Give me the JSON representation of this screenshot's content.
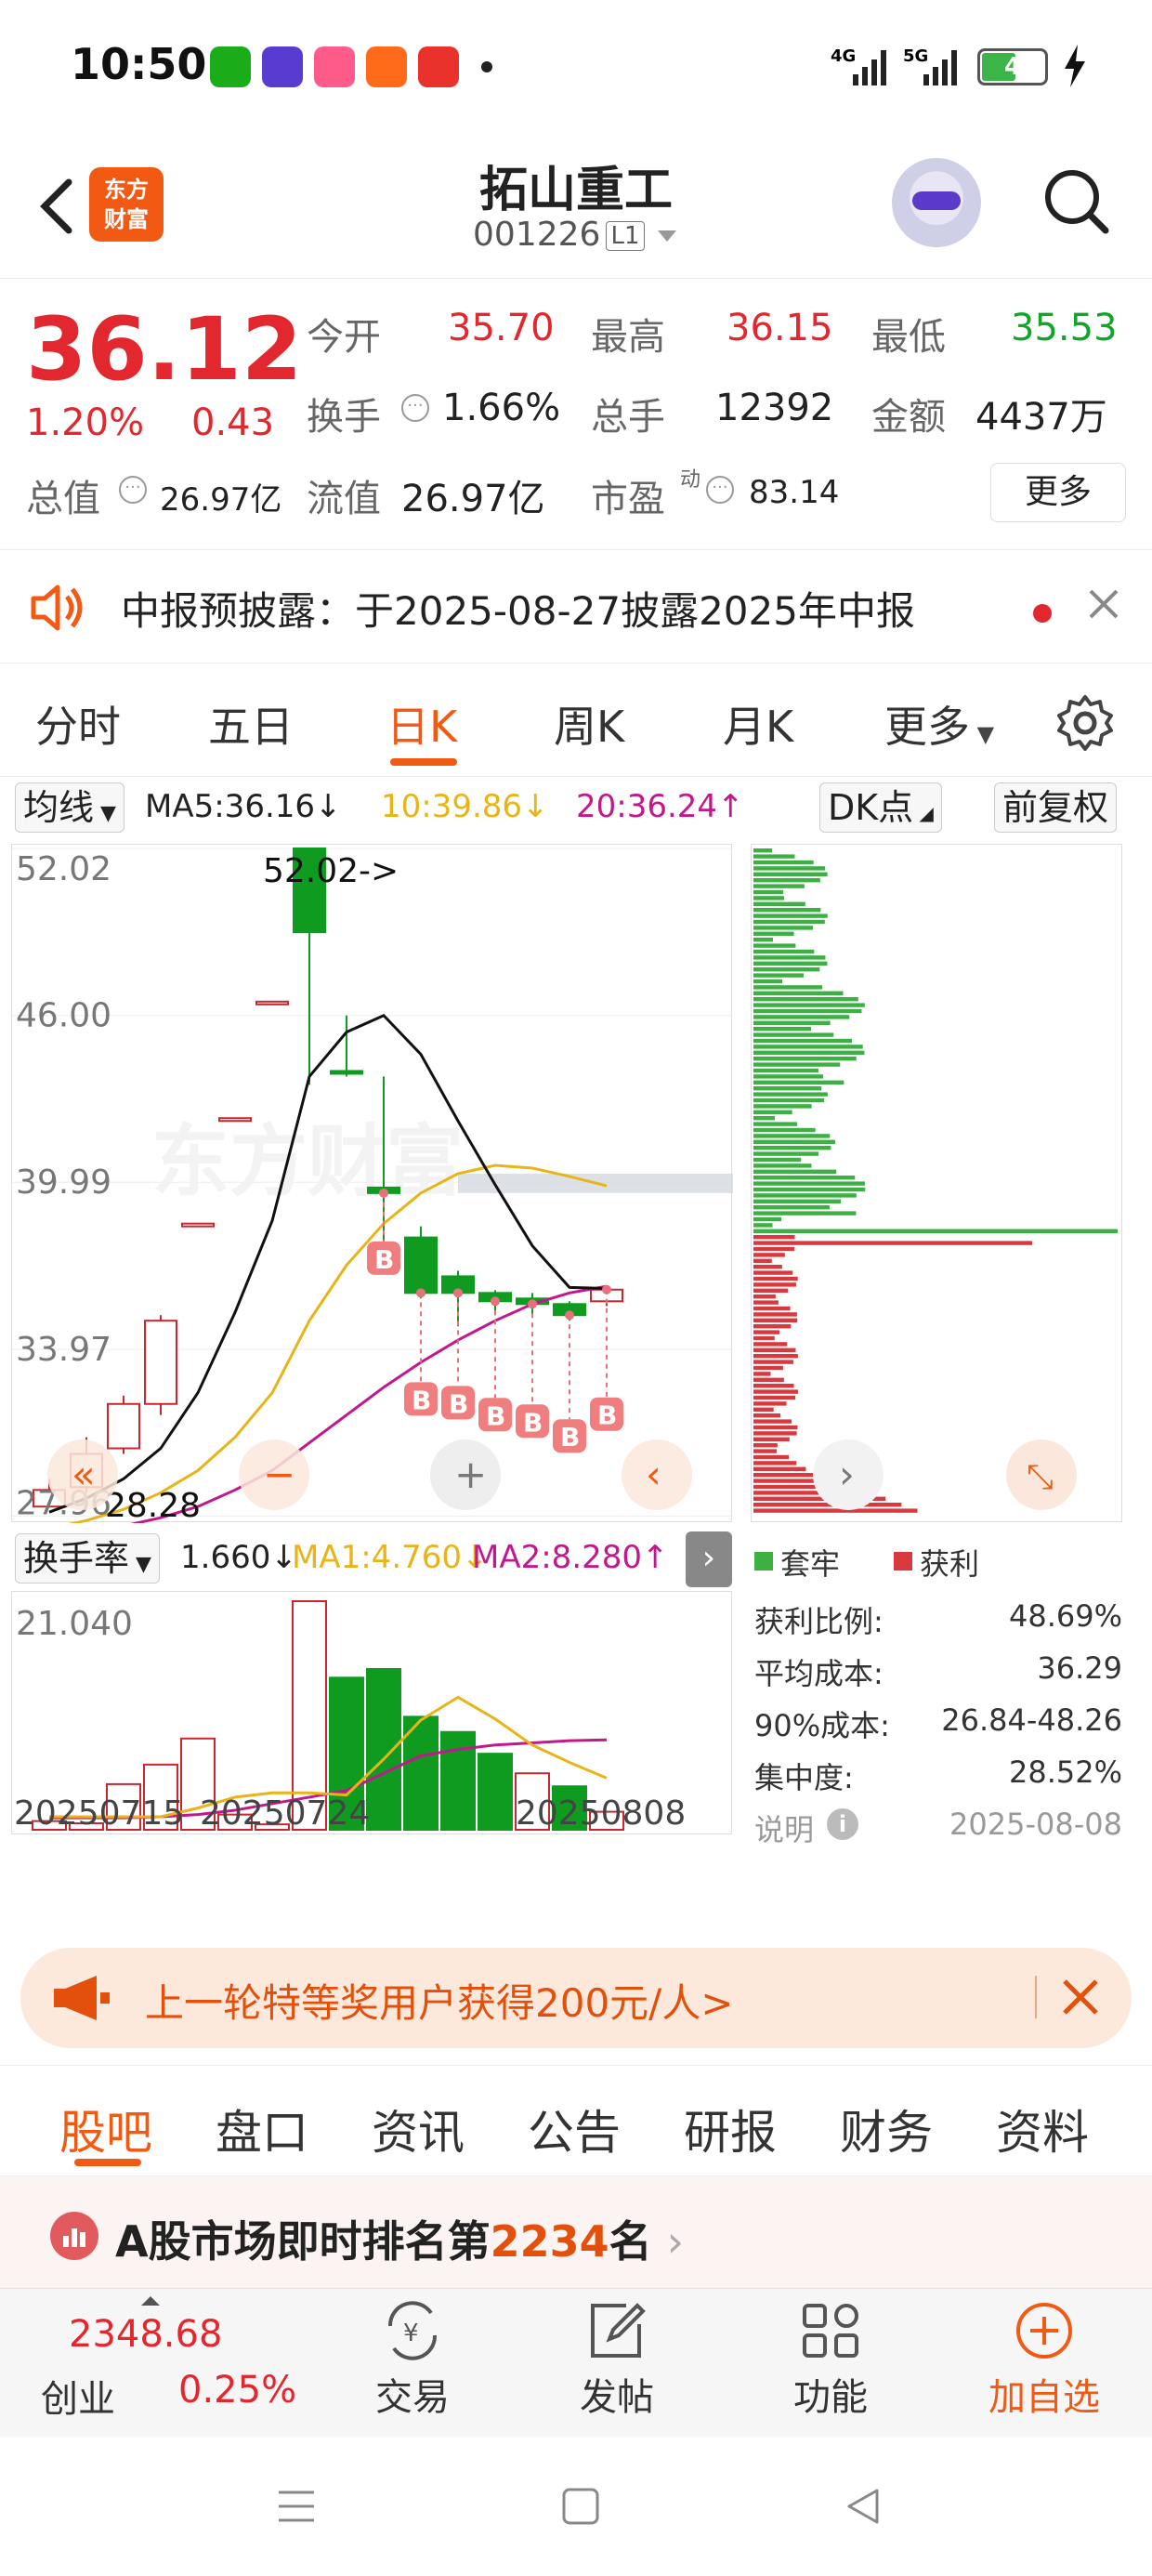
{
  "status_bar": {
    "time": "10:50",
    "network": "4G 5G",
    "battery": "4"
  },
  "header": {
    "logo_text": "东方\n财富",
    "stock_name": "拓山重工",
    "stock_code": "001226",
    "level_badge": "L1"
  },
  "quote": {
    "price": "36.12",
    "change_pct": "1.20%",
    "change_amt": "0.43",
    "fields": [
      {
        "label": "今开",
        "value": "35.70",
        "color": "#e2272e"
      },
      {
        "label": "最高",
        "value": "36.15",
        "color": "#e2272e"
      },
      {
        "label": "最低",
        "value": "35.53",
        "color": "#13a52a"
      },
      {
        "label": "换手",
        "value": "1.66%",
        "color": "#222222"
      },
      {
        "label": "总手",
        "value": "12392",
        "color": "#222222"
      },
      {
        "label": "金额",
        "value": "4437万",
        "color": "#222222"
      },
      {
        "label": "总值",
        "value": "26.97亿",
        "color": "#222222"
      },
      {
        "label": "流值",
        "value": "26.97亿",
        "color": "#222222"
      },
      {
        "label": "市盈",
        "value": "83.14",
        "color": "#222222"
      }
    ],
    "pe_superscript": "动",
    "more_label": "更多"
  },
  "notice": {
    "text": "中报预披露：于2025-08-27披露2025年中报"
  },
  "period_tabs": [
    "分时",
    "五日",
    "日K",
    "周K",
    "月K",
    "更多"
  ],
  "active_period": "日K",
  "ma_row": {
    "selector": "均线",
    "ma5": "MA5:36.16",
    "ma10": "10:39.86",
    "ma20": "20:36.24",
    "dk_button": "DK点",
    "adjust_button": "前复权"
  },
  "kline": {
    "y_labels": [
      "52.02",
      "46.00",
      "39.99",
      "33.97",
      "27.96"
    ],
    "high_marker": "52.02->",
    "low_marker": "28.28",
    "buy_marker": "B"
  },
  "turnover": {
    "selector": "换手率",
    "value": "1.660",
    "ma1": "MA1:4.760",
    "ma2": "MA2:8.280",
    "y_max": "21.040",
    "dates": [
      "20250715",
      "20250724",
      "20250808"
    ]
  },
  "chip": {
    "legend_trapped": "套牢",
    "legend_profit": "获利",
    "stats": [
      {
        "label": "获利比例:",
        "value": "48.69%"
      },
      {
        "label": "平均成本:",
        "value": "36.29"
      },
      {
        "label": "90%成本:",
        "value": "26.84-48.26"
      },
      {
        "label": "集中度:",
        "value": "28.52%"
      }
    ],
    "note_label": "说明",
    "date": "2025-08-08"
  },
  "banner": {
    "text": "上一轮特等奖用户获得200元/人>"
  },
  "bottom_tabs": [
    "股吧",
    "盘口",
    "资讯",
    "公告",
    "研报",
    "财务",
    "资料"
  ],
  "active_bottom_tab": "股吧",
  "rank": {
    "prefix": "A股市场即时排名第",
    "number": "2234",
    "suffix": "名"
  },
  "nav": {
    "index_value": "2348.68",
    "index_name": "创业",
    "index_change": "0.25%",
    "items": [
      "交易",
      "发帖",
      "功能",
      "加自选"
    ]
  },
  "chart_data": {
    "type": "candlestick",
    "ylim": [
      27.96,
      52.02
    ],
    "y_ticks": [
      52.02,
      46.0,
      39.99,
      33.97,
      27.96
    ],
    "candles": [
      {
        "o": 28.3,
        "c": 28.9,
        "h": 29.3,
        "l": 28.28,
        "up": true
      },
      {
        "o": 29.0,
        "c": 30.2,
        "h": 30.8,
        "l": 28.8,
        "up": true
      },
      {
        "o": 30.4,
        "c": 32.0,
        "h": 32.3,
        "l": 30.2,
        "up": true
      },
      {
        "o": 32.0,
        "c": 35.0,
        "h": 35.2,
        "l": 31.6,
        "up": true
      },
      {
        "o": 38.5,
        "c": 38.5,
        "h": 38.5,
        "l": 38.5,
        "up": true
      },
      {
        "o": 42.3,
        "c": 42.3,
        "h": 42.3,
        "l": 42.3,
        "up": true
      },
      {
        "o": 46.5,
        "c": 46.5,
        "h": 46.5,
        "l": 46.5,
        "up": true
      },
      {
        "o": 52.02,
        "c": 49.0,
        "h": 52.02,
        "l": 43.5,
        "up": false
      },
      {
        "o": 44.0,
        "c": 44.0,
        "h": 46.0,
        "l": 43.8,
        "up": false
      },
      {
        "o": 39.8,
        "c": 39.6,
        "h": 43.8,
        "l": 37.8,
        "up": false
      },
      {
        "o": 38.0,
        "c": 36.0,
        "h": 38.4,
        "l": 35.8,
        "up": false
      },
      {
        "o": 36.6,
        "c": 36.0,
        "h": 36.8,
        "l": 34.8,
        "up": false
      },
      {
        "o": 36.0,
        "c": 35.7,
        "h": 36.1,
        "l": 35.2,
        "up": false
      },
      {
        "o": 35.8,
        "c": 35.6,
        "h": 36.0,
        "l": 35.2,
        "up": false
      },
      {
        "o": 35.6,
        "c": 35.2,
        "h": 35.7,
        "l": 35.0,
        "up": false
      },
      {
        "o": 35.7,
        "c": 36.12,
        "h": 36.15,
        "l": 35.53,
        "up": true
      }
    ],
    "ma5": [
      28.1,
      28.6,
      29.3,
      30.4,
      32.4,
      35.3,
      38.6,
      43.8,
      45.4,
      46.0,
      44.6,
      42.2,
      39.9,
      37.7,
      36.2,
      36.16
    ],
    "ma10": [
      27.5,
      27.8,
      28.2,
      28.8,
      29.6,
      30.8,
      32.4,
      35.0,
      37.0,
      38.5,
      39.6,
      40.3,
      40.6,
      40.5,
      40.2,
      39.86
    ],
    "ma20": [
      27.0,
      27.3,
      27.6,
      27.9,
      28.3,
      28.9,
      29.6,
      30.6,
      31.6,
      32.6,
      33.5,
      34.3,
      35.0,
      35.6,
      36.0,
      36.24
    ],
    "turnover": [
      0.8,
      0.6,
      4.2,
      6.0,
      8.4,
      1.4,
      0.5,
      21.04,
      14.0,
      14.8,
      10.4,
      9.0,
      7.0,
      5.2,
      4.0,
      1.66
    ],
    "turnover_up": [
      true,
      true,
      true,
      true,
      true,
      true,
      true,
      true,
      false,
      false,
      false,
      false,
      false,
      true,
      false,
      true
    ],
    "turnover_ma1": [
      1.2,
      1.2,
      1.2,
      1.2,
      2.0,
      3.0,
      3.4,
      3.4,
      3.2,
      6.5,
      10.1,
      12.2,
      10.2,
      7.8,
      6.2,
      4.76
    ],
    "turnover_ma2": [
      1.1,
      1.1,
      1.1,
      1.2,
      1.4,
      1.8,
      2.4,
      3.0,
      3.6,
      5.2,
      6.8,
      7.4,
      7.8,
      8.0,
      8.2,
      8.28
    ]
  }
}
